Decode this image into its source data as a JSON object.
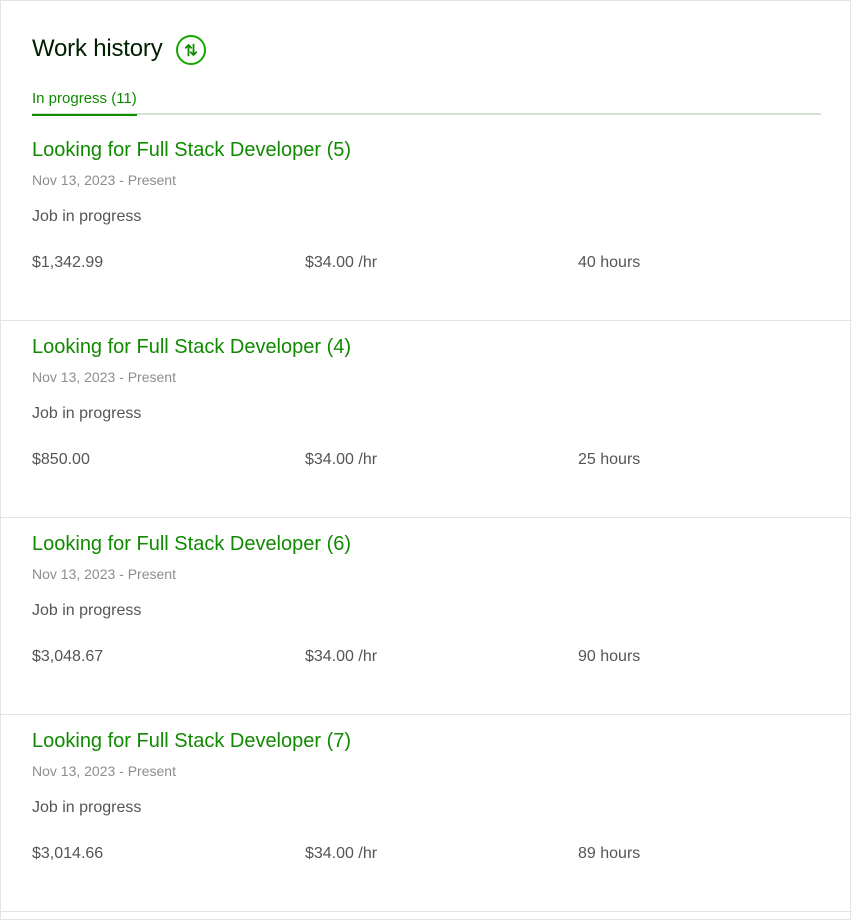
{
  "header": {
    "title": "Work history",
    "sort_icon": "sort-arrows-icon"
  },
  "tabs": [
    {
      "label": "In progress (11)",
      "active": true
    }
  ],
  "colors": {
    "accent": "#108a00",
    "title": "#001e00",
    "muted": "#8a8f8a",
    "text": "#555555",
    "divider": "#e4e4e4"
  },
  "jobs": [
    {
      "title": "Looking for Full Stack Developer (5)",
      "date": "Nov 13, 2023 - Present",
      "status": "Job in progress",
      "earned": "$1,342.99",
      "rate": "$34.00 /hr",
      "hours": "40 hours"
    },
    {
      "title": "Looking for Full Stack Developer (4)",
      "date": "Nov 13, 2023 - Present",
      "status": "Job in progress",
      "earned": "$850.00",
      "rate": "$34.00 /hr",
      "hours": "25 hours"
    },
    {
      "title": "Looking for Full Stack Developer (6)",
      "date": "Nov 13, 2023 - Present",
      "status": "Job in progress",
      "earned": "$3,048.67",
      "rate": "$34.00 /hr",
      "hours": "90 hours"
    },
    {
      "title": "Looking for Full Stack Developer (7)",
      "date": "Nov 13, 2023 - Present",
      "status": "Job in progress",
      "earned": "$3,014.66",
      "rate": "$34.00 /hr",
      "hours": "89 hours"
    }
  ]
}
